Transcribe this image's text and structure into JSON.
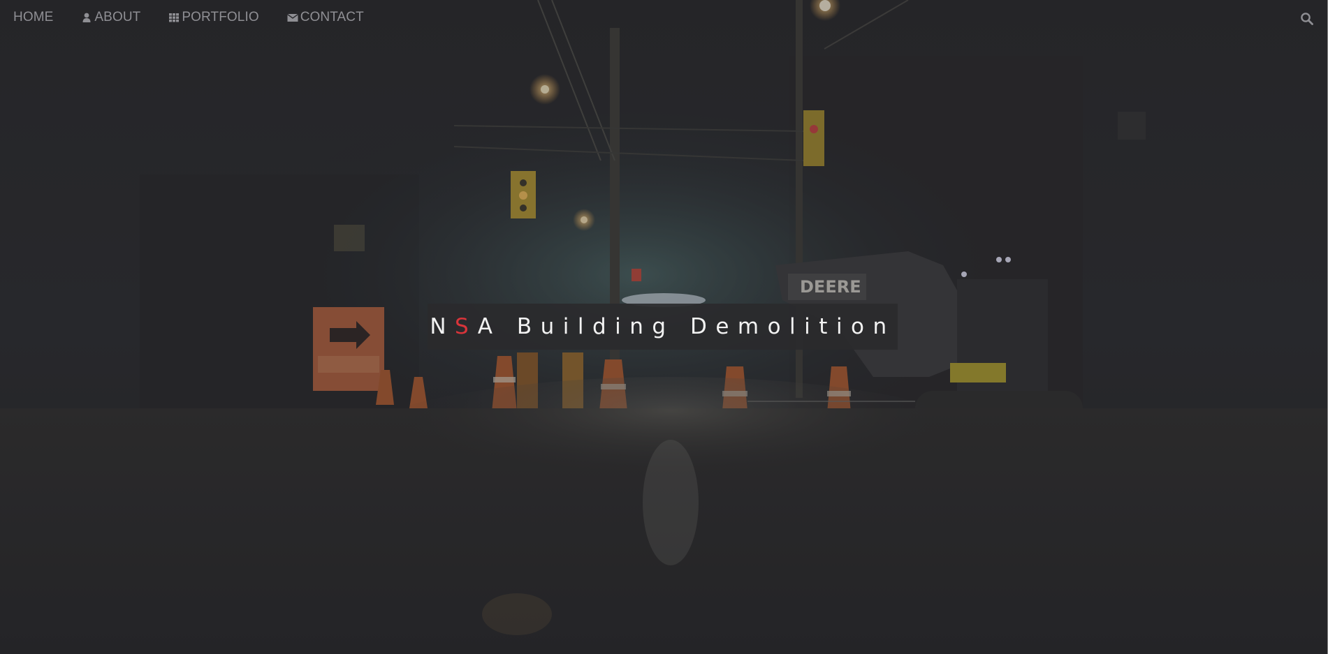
{
  "navbar": {
    "items": [
      {
        "label": "HOME",
        "icon": null
      },
      {
        "label": "ABOUT",
        "icon": "user-icon"
      },
      {
        "label": "PORTFOLIO",
        "icon": "grid-icon"
      },
      {
        "label": "CONTACT",
        "icon": "envelope-icon"
      }
    ],
    "search_icon": "search-icon"
  },
  "hero": {
    "title_part1": "N",
    "title_accent": "S",
    "title_part2": "A Building Demolition",
    "accent_color": "#d9343a",
    "background_image": "night street construction scene with excavator, traffic cones and street lights"
  },
  "colors": {
    "nav_text": "#8f8f94",
    "title_box": "#2a2a2c",
    "title_text": "#f2f2f2"
  }
}
